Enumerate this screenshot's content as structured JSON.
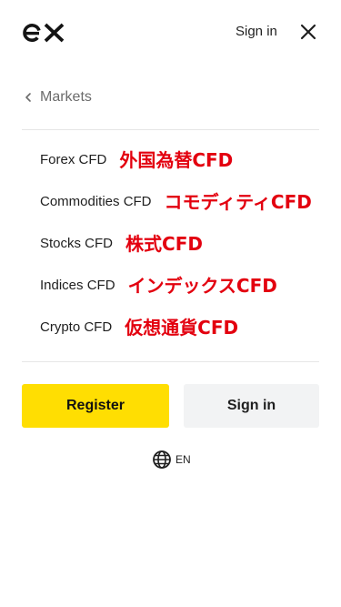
{
  "header": {
    "logo_text": "ex",
    "signin_label": "Sign in",
    "close_icon": "close-icon"
  },
  "back": {
    "label": "Markets",
    "icon": "chevron-left-icon"
  },
  "menu": {
    "items": [
      {
        "label": "Forex CFD",
        "annotation": "外国為替CFD"
      },
      {
        "label": "Commodities CFD",
        "annotation": "コモディティCFD"
      },
      {
        "label": "Stocks CFD",
        "annotation": "株式CFD"
      },
      {
        "label": "Indices CFD",
        "annotation": "インデックスCFD"
      },
      {
        "label": "Crypto CFD",
        "annotation": "仮想通貨CFD"
      }
    ]
  },
  "buttons": {
    "register_label": "Register",
    "signin_label": "Sign in"
  },
  "language": {
    "code": "EN",
    "icon": "globe-icon"
  },
  "colors": {
    "accent": "#ffde02",
    "annotation": "#e3000f",
    "muted_text": "#6b6b6b",
    "secondary_button": "#f2f3f4"
  }
}
